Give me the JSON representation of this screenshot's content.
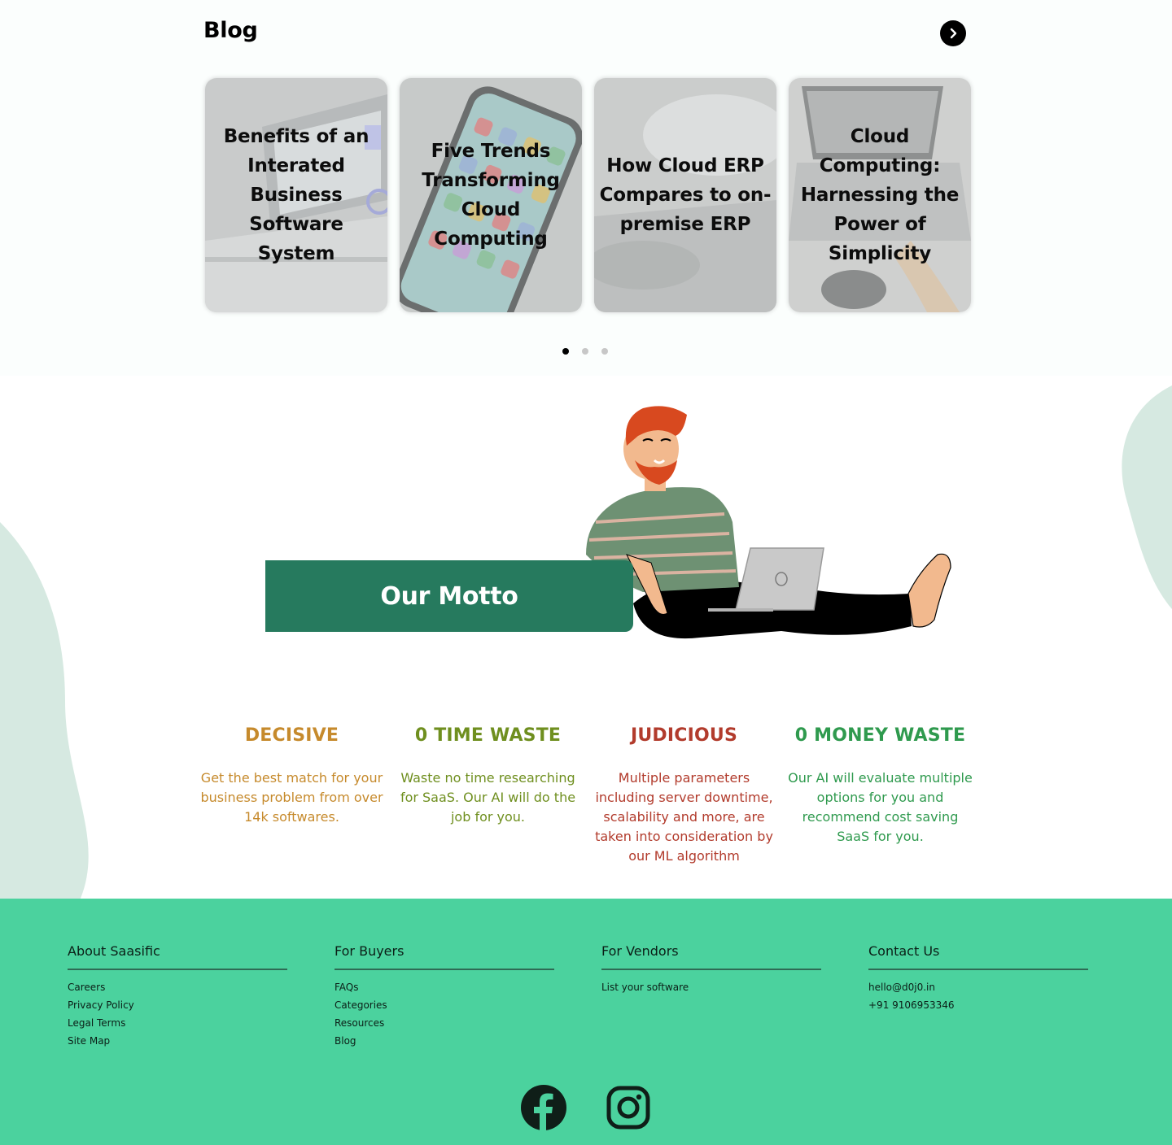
{
  "blog": {
    "title": "Blog",
    "next_label": "next",
    "cards": [
      {
        "title": "Benefits of an Interated Business Software System"
      },
      {
        "title": "Five Trends Transforming Cloud Computing"
      },
      {
        "title": "How Cloud ERP Compares to on-premise ERP"
      },
      {
        "title": "Cloud Computing: Harnessing the Power of Simplicity"
      }
    ],
    "page_count": 3,
    "active_page": 1
  },
  "motto": {
    "button_label": "Our Motto",
    "features": [
      {
        "heading": "DECISIVE",
        "text": "Get the best match for your business problem from over 14k softwares.",
        "color": "#c68a2c"
      },
      {
        "heading": "0 TIME WASTE",
        "text": "Waste no time researching for SaaS. Our AI will do the job for you.",
        "color": "#6f8f1f"
      },
      {
        "heading": "JUDICIOUS",
        "text": "Multiple parameters including server downtime, scalability and more, are taken into consideration by our ML algorithm",
        "color": "#b23b2c"
      },
      {
        "heading": "0 MONEY WASTE",
        "text": "Our AI will evaluate multiple options for you and recommend cost saving SaaS for you.",
        "color": "#2f9a4e"
      }
    ]
  },
  "footer": {
    "columns": [
      {
        "heading": "About Saasific",
        "links": [
          "Careers",
          "Privacy Policy",
          "Legal Terms",
          "Site Map"
        ]
      },
      {
        "heading": "For Buyers",
        "links": [
          "FAQs",
          "Categories",
          "Resources",
          "Blog"
        ]
      },
      {
        "heading": "For Vendors",
        "links": [
          "List your software"
        ]
      },
      {
        "heading": "Contact Us",
        "links": [
          "hello@d0j0.in",
          "+91 9106953346"
        ]
      }
    ],
    "social": [
      "facebook-icon",
      "instagram-icon"
    ]
  },
  "colors": {
    "motto_green": "#267a5e",
    "footer_green": "#4bd29e",
    "blob": "#d6e9e1"
  }
}
